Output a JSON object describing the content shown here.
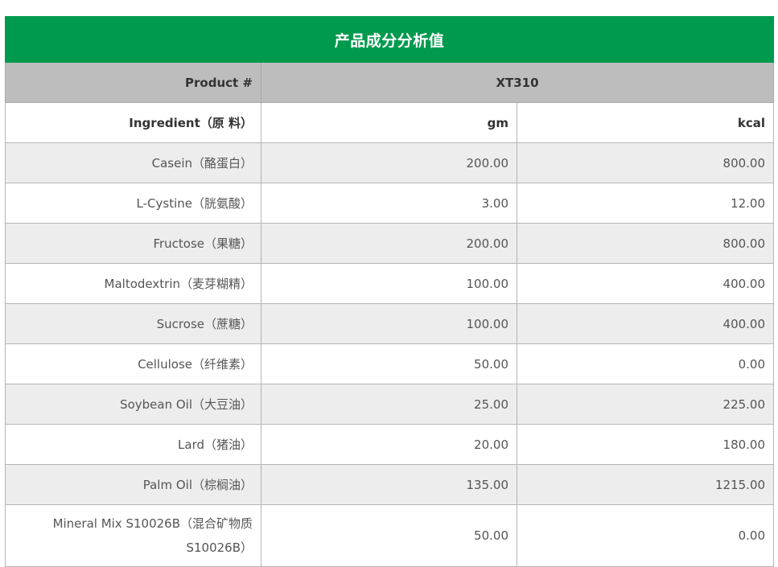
{
  "title": "产品成分分析值",
  "product_label": "Product #",
  "product_code": "XT310",
  "header": {
    "ingredient": "Ingredient（原 料）",
    "gm": "gm",
    "kcal": "kcal"
  },
  "rows": [
    {
      "name": "Casein（酪蛋白）",
      "gm": "200.00",
      "kcal": "800.00"
    },
    {
      "name": "L-Cystine（胱氨酸）",
      "gm": "3.00",
      "kcal": "12.00"
    },
    {
      "name": "Fructose（果糖）",
      "gm": "200.00",
      "kcal": "800.00"
    },
    {
      "name": "Maltodextrin（麦芽糊精）",
      "gm": "100.00",
      "kcal": "400.00"
    },
    {
      "name": "Sucrose（蔗糖）",
      "gm": "100.00",
      "kcal": "400.00"
    },
    {
      "name": "Cellulose（纤维素）",
      "gm": "50.00",
      "kcal": "0.00"
    },
    {
      "name": "Soybean Oil（大豆油）",
      "gm": "25.00",
      "kcal": "225.00"
    },
    {
      "name": "Lard（猪油）",
      "gm": "20.00",
      "kcal": "180.00"
    },
    {
      "name": "Palm Oil（棕榈油）",
      "gm": "135.00",
      "kcal": "1215.00"
    },
    {
      "name": "Mineral Mix S10026B（混合矿物质 S10026B）",
      "gm": "50.00",
      "kcal": "0.00"
    }
  ]
}
